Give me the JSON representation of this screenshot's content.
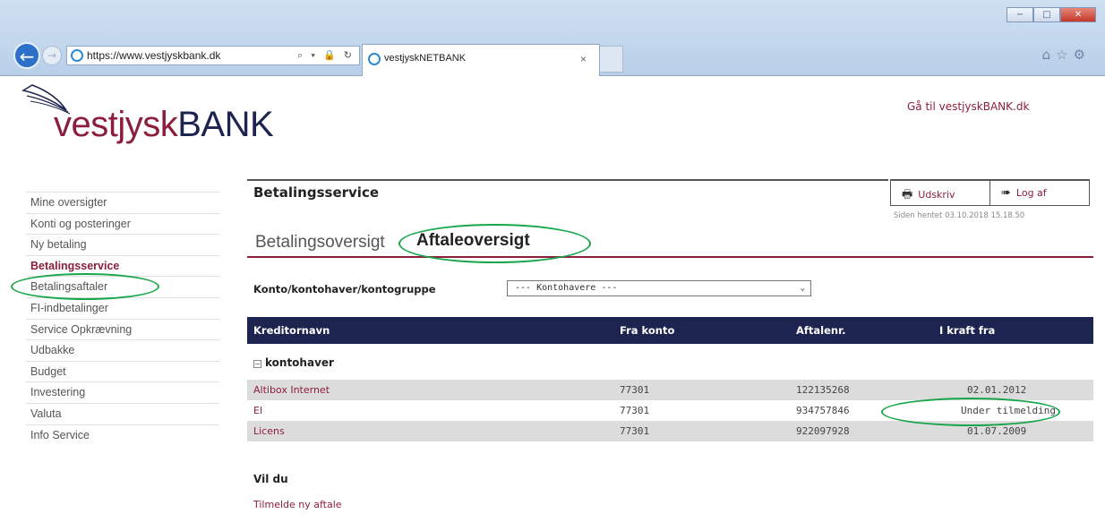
{
  "browser": {
    "address": "https://www.vestjyskbank.dk",
    "address_tools": "⌕ ▾ 🔒 ↻",
    "tab_title": "vestjyskNETBANK",
    "tab_close": "×",
    "window_buttons": {
      "minimize": "−",
      "maximize": "□",
      "close": "✕"
    },
    "tool_icons": "⌂☆⚙"
  },
  "header": {
    "logo_part1": "vestjysk",
    "logo_part2": "BANK",
    "goto_link": "Gå til vestjyskBANK.dk"
  },
  "sidebar": {
    "items": [
      {
        "label": "Mine oversigter"
      },
      {
        "label": "Konti og posteringer"
      },
      {
        "label": "Ny betaling"
      },
      {
        "label": "Betalingsservice"
      },
      {
        "label": "Betalingsaftaler"
      },
      {
        "label": "FI-indbetalinger"
      },
      {
        "label": "Service Opkrævning"
      },
      {
        "label": "Udbakke"
      },
      {
        "label": "Budget"
      },
      {
        "label": "Investering"
      },
      {
        "label": "Valuta"
      },
      {
        "label": "Info Service"
      }
    ],
    "active_index": 3
  },
  "main": {
    "title": "Betalingsservice",
    "print_label": "Udskriv",
    "logout_label": "Log af",
    "fetched_text": "Siden hentet 03.10.2018 15.18.50",
    "tabs": {
      "betalingsoversigt": "Betalingsoversigt",
      "aftaleoversigt": "Aftaleoversigt"
    },
    "filter_label": "Konto/kontohaver/kontogruppe",
    "filter_value": "--- Kontohavere ---",
    "table": {
      "headers": [
        "Kreditornavn",
        "Fra konto",
        "Aftalenr.",
        "I kraft fra"
      ],
      "group": "kontohaver",
      "rows": [
        {
          "name": "Altibox Internet",
          "account": "77301",
          "agreement": "122135268",
          "effective": "02.01.2012"
        },
        {
          "name": "El",
          "account": "77301",
          "agreement": "934757846",
          "effective": "Under tilmelding"
        },
        {
          "name": "Licens",
          "account": "77301",
          "agreement": "922097928",
          "effective": "01.07.2009"
        }
      ]
    },
    "vil_du": "Vil du",
    "tilmelde_link": "Tilmelde ny aftale"
  },
  "colors": {
    "brand": "#8c1f3b",
    "navy": "#1d2450",
    "highlight": "#19a54a"
  }
}
